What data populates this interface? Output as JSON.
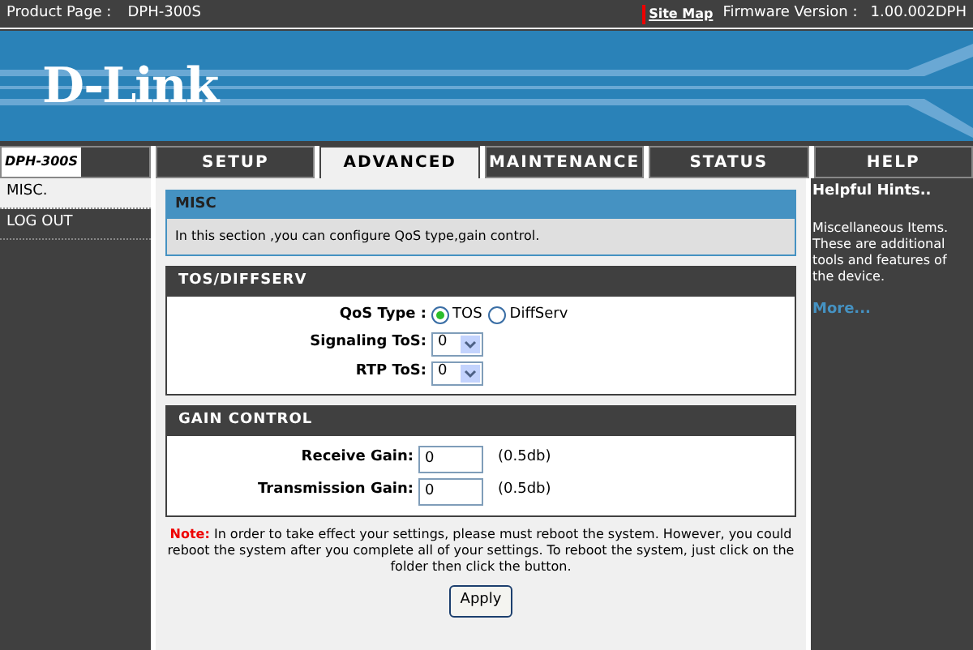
{
  "top_bar": {
    "product_label": "Product Page :",
    "product": "DPH-300S",
    "site_map": "Site Map",
    "firmware_label": "Firmware Version :",
    "firmware": "1.00.002DPH"
  },
  "banner": {
    "logo": "D-Link"
  },
  "model_badge": "DPH-300S",
  "tabs": [
    {
      "label": "SETUP",
      "selected": false
    },
    {
      "label": "ADVANCED",
      "selected": true
    },
    {
      "label": "MAINTENANCE",
      "selected": false
    },
    {
      "label": "STATUS",
      "selected": false
    },
    {
      "label": "HELP",
      "selected": false
    }
  ],
  "sidebar": {
    "items": [
      {
        "label": "MISC.",
        "selected": true
      },
      {
        "label": "LOG OUT",
        "selected": false
      }
    ]
  },
  "intro": {
    "title": "MISC",
    "text": "In this section ,you can configure QoS type,gain control."
  },
  "tos_section": {
    "title": "TOS/DIFFSERV",
    "qos_label": "QoS Type :",
    "qos_options": [
      {
        "label": "TOS",
        "selected": true
      },
      {
        "label": "DiffServ",
        "selected": false
      }
    ],
    "selects": [
      {
        "label": "Signaling ToS:",
        "value": "0"
      },
      {
        "label": "RTP ToS:",
        "value": "0"
      }
    ]
  },
  "gain_section": {
    "title": "GAIN CONTROL",
    "rows": [
      {
        "label": "Receive Gain:",
        "value": "0",
        "unit": "(0.5db)"
      },
      {
        "label": "Transmission Gain:",
        "value": "0",
        "unit": "(0.5db)"
      }
    ]
  },
  "note": {
    "label": "Note:",
    "text": "In order to take effect your settings, please must reboot the system. However, you could reboot the system after you complete all of your settings. To reboot the system, just click on the folder then click the button."
  },
  "apply_button": "Apply",
  "hints": {
    "title": "Helpful Hints..",
    "text": "Miscellaneous Items. These are additional tools and features of the device.",
    "more": "More..."
  }
}
